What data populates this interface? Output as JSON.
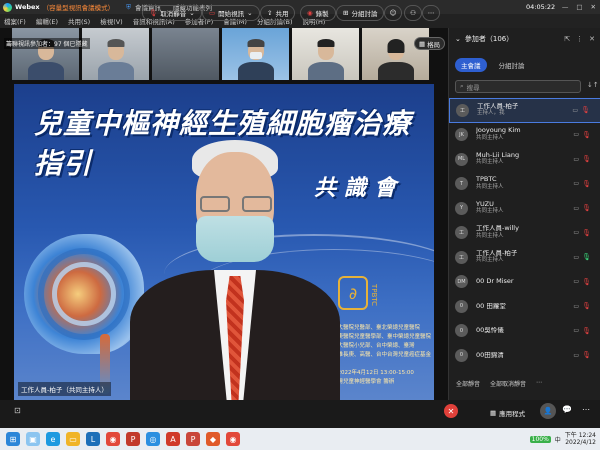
{
  "titlebar": {
    "app_name": "Webex",
    "mode": "（容量型視訊會議模式）",
    "info": "會議資訊",
    "hide_menu": "隱藏功能表列",
    "timer": "04:05:22",
    "window_controls": [
      "—",
      "□",
      "✕"
    ]
  },
  "menubar": {
    "items": [
      "檔案(F)",
      "編輯(E)",
      "共用(S)",
      "檢視(V)",
      "音訊和視訊(A)",
      "參加者(P)",
      "會議(M)",
      "分組討論(B)",
      "說明(H)"
    ]
  },
  "stage": {
    "speaker_label": "籌聯視訊參加者：97 個已隱藏",
    "grid_button": "格局"
  },
  "share": {
    "title": "兒童中樞神經生殖細胞瘤治療指引",
    "subtitle": "共識會",
    "logo_text": "TPBTC",
    "logo_sub": "Taiwan Pediatric Brain Tumor Consortium",
    "org_lines": [
      "臺大醫院兒醫部、臺北榮總兒童醫院",
      "長庚醫院兒童醫學部、臺中榮總兒童醫院",
      "成大醫院小兒部、台中榮總、臺灣",
      "高雄長庚、高醫、台中台灣兒童癌症基金會",
      "…2022年4月12日 13:00-15:00",
      "台灣兒童神經醫學會 籌辦"
    ],
    "name_tag": "工作人員-柏子（共同主持人）"
  },
  "panel": {
    "title": "參加者（106）",
    "tabs": [
      "主會議",
      "分組討論"
    ],
    "search_placeholder": "搜尋",
    "participants": [
      {
        "initials": "工",
        "name": "工作人員-柏子",
        "role": "主持人，我",
        "mic_on": false,
        "selected": true
      },
      {
        "initials": "JK",
        "name": "Jooyoung Kim",
        "role": "共同主持人",
        "mic_on": false,
        "selected": false
      },
      {
        "initials": "ML",
        "name": "Muh-Lii Liang",
        "role": "共同主持人",
        "mic_on": false,
        "selected": false
      },
      {
        "initials": "T",
        "name": "TPBTC",
        "role": "共同主持人",
        "mic_on": false,
        "selected": false
      },
      {
        "initials": "Y",
        "name": "YUZU",
        "role": "共同主持人",
        "mic_on": false,
        "selected": false
      },
      {
        "initials": "工",
        "name": "工作人員-willy",
        "role": "共同主持人",
        "mic_on": false,
        "selected": false
      },
      {
        "initials": "工",
        "name": "工作人員-柏子",
        "role": "共同主持人",
        "mic_on": true,
        "selected": false
      },
      {
        "initials": "DM",
        "name": "00 Dr Miser",
        "role": "",
        "mic_on": false,
        "selected": false
      },
      {
        "initials": "0",
        "name": "00 田蘿堂",
        "role": "",
        "mic_on": false,
        "selected": false
      },
      {
        "initials": "0",
        "name": "00吳怜儀",
        "role": "",
        "mic_on": false,
        "selected": false
      },
      {
        "initials": "0",
        "name": "00田錦清",
        "role": "",
        "mic_on": false,
        "selected": false
      }
    ],
    "foot": [
      "全部靜音",
      "全部取消靜音"
    ]
  },
  "controls": {
    "unmute": "取消靜音",
    "start_video": "開始視訊",
    "share": "共用",
    "record": "錄製",
    "breakout": "分組討論",
    "apps": "應用程式"
  },
  "taskbar": {
    "battery": "100%",
    "ime": "中",
    "time": "下午 12:24",
    "date": "2022/4/12"
  },
  "colors": {
    "accent": "#2e5fd0",
    "leave": "#e0403a",
    "mode": "#ff8c3a"
  }
}
